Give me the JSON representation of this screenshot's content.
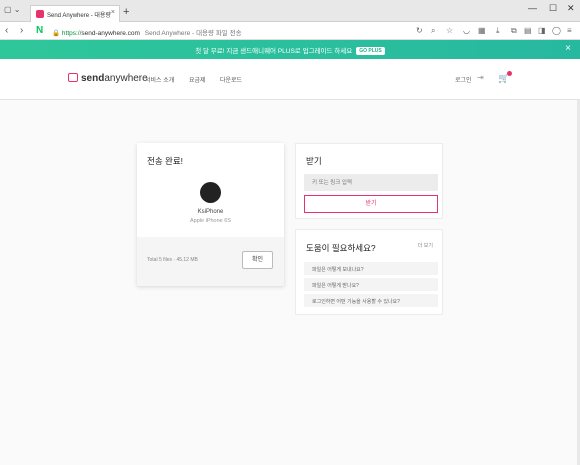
{
  "browser": {
    "tab_title": "Send Anywhere - 대용량",
    "tab_close": "×",
    "new_tab": "+",
    "url_lock": "🔒",
    "url_scheme": "https://",
    "url_host": "send-anywhere.com",
    "page_title": "Send Anywhere - 대용량 파일 전송",
    "n_logo": "N"
  },
  "promo": {
    "text": "첫 달 무료! 지금 샌드애니웨어 PLUS로 업그레이드 하세요",
    "chip": "GO PLUS",
    "close": "×"
  },
  "header": {
    "logo_bold": "send",
    "logo_light": "anywhere",
    "menu": [
      "서비스 소개",
      "요금제",
      "다운로드"
    ],
    "login": "로그인"
  },
  "done_card": {
    "title": "전송 완료!",
    "device_name": "KsiPhone",
    "device_model": "Apple iPhone 6S",
    "total": "Total 5 files · 45.12 MB",
    "confirm": "확인"
  },
  "receive_card": {
    "title": "받기",
    "placeholder": "키 또는 링크 입력",
    "button": "받기"
  },
  "help_card": {
    "title": "도움이 필요하세요?",
    "more": "더 보기",
    "faqs": [
      "파일은 어떻게 보내나요?",
      "파일은 어떻게 받나요?",
      "로그인하면 어떤 기능을 사용할 수 있나요?"
    ]
  },
  "colors": {
    "brand": "#e7336b",
    "promo": "#2ec79a"
  }
}
